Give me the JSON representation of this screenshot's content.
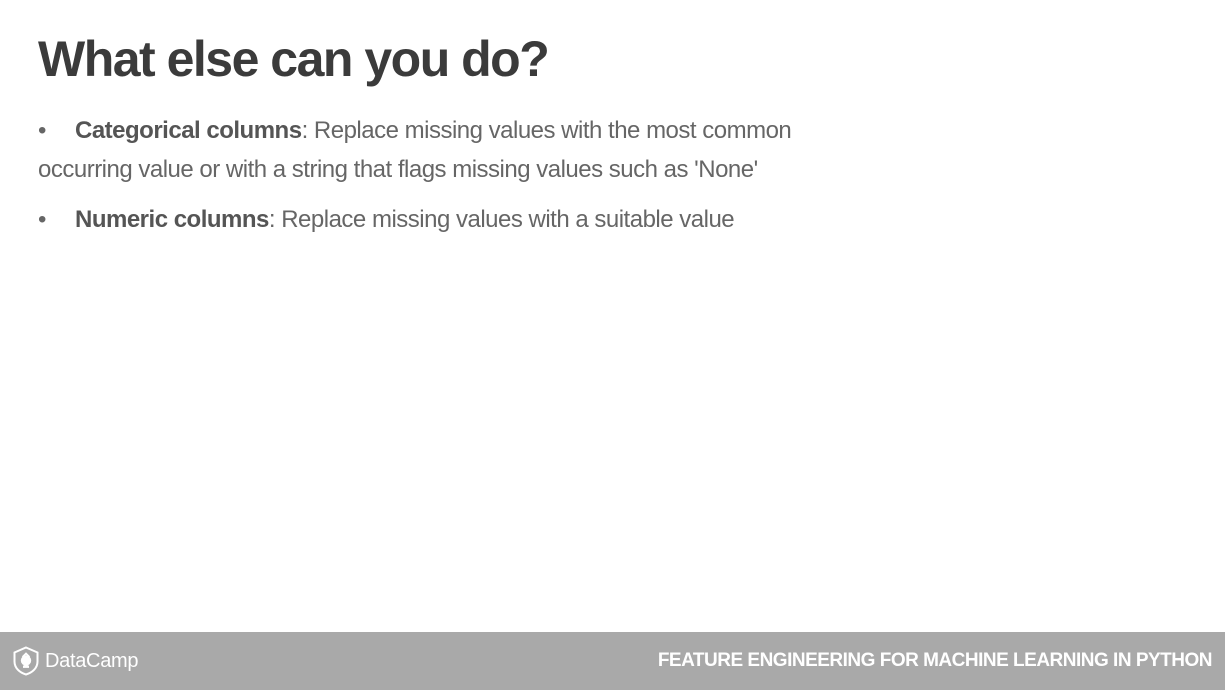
{
  "slide": {
    "title": "What else can you do?"
  },
  "bullets": [
    {
      "marker": "•",
      "term": "Categorical columns",
      "text": ": Replace missing values with the most common occurring value or with a string that flags missing values such as 'None'"
    },
    {
      "marker": "•",
      "term": "Numeric columns",
      "text": ": Replace missing values with a suitable value"
    }
  ],
  "footer": {
    "logo_icon": "datacamp-shield-icon",
    "logo_text": "DataCamp",
    "course_title": "FEATURE ENGINEERING FOR MACHINE LEARNING IN PYTHON",
    "bar_color": "#a9a9a9"
  }
}
